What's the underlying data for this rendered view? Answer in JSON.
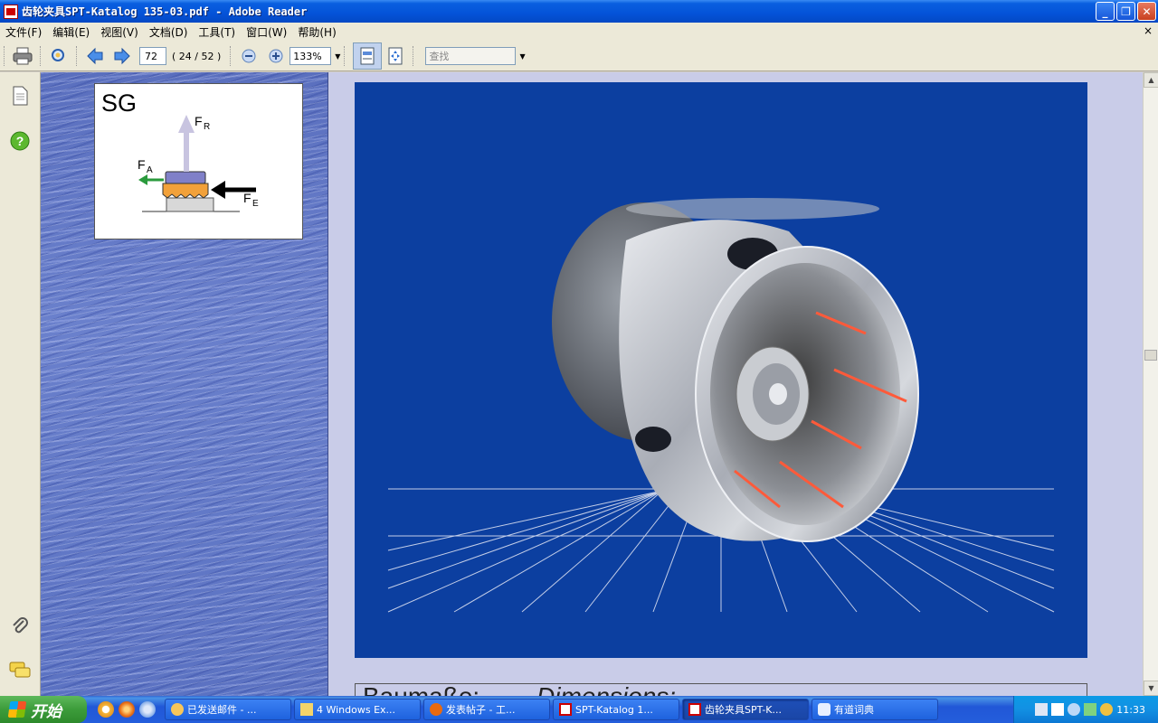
{
  "window": {
    "title": "齿轮夹具SPT-Katalog 135-03.pdf - Adobe Reader"
  },
  "menu": {
    "items": [
      "文件(F)",
      "编辑(E)",
      "视图(V)",
      "文档(D)",
      "工具(T)",
      "窗口(W)",
      "帮助(H)"
    ],
    "close_glyph": "×"
  },
  "toolbar": {
    "page_number": "72",
    "page_count": "( 24 / 52 )",
    "zoom": "133%",
    "search_placeholder": "查找"
  },
  "document": {
    "sg_title": "SG",
    "force_labels": {
      "fr": "F",
      "fr_sub": "R",
      "fa": "F",
      "fa_sub": "A",
      "fe": "F",
      "fe_sub": "E"
    },
    "bottom_heading_left": "Baumaße:",
    "bottom_heading_right": "Dimensions:"
  },
  "taskbar": {
    "start_label": "开始",
    "tasks": [
      {
        "label": "已发送邮件 - ...",
        "icon": "mail-icon"
      },
      {
        "label": "4 Windows Ex...",
        "icon": "folder-icon"
      },
      {
        "label": "发表帖子 - 工...",
        "icon": "firefox-icon"
      },
      {
        "label": "SPT-Katalog 1...",
        "icon": "pdf-icon"
      },
      {
        "label": "齿轮夹具SPT-K...",
        "icon": "pdf-icon"
      },
      {
        "label": "有道词典",
        "icon": "dictionary-icon"
      }
    ],
    "clock": "11:33"
  },
  "colors": {
    "titlebar": "#0453d8",
    "panel_blue": "#0c3fa0",
    "taskbar": "#245edc",
    "start_green": "#3c9c3a"
  }
}
